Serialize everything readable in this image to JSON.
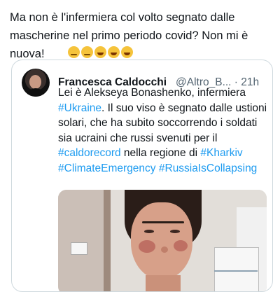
{
  "outer_tweet": {
    "text": "Ma non è l'infermiera col volto segnato dalle mascherine nel primo periodo covid? Non mi è nuova!",
    "emojis": [
      "thinking-face-icon",
      "eye-roll-icon",
      "rolling-laugh-icon",
      "rolling-laugh-icon",
      "rolling-laugh-icon"
    ]
  },
  "quoted_tweet": {
    "author_name": "Francesca Caldocchi",
    "handle": "@Altro_B...",
    "timestamp": "· 21h",
    "more_label": "⋮",
    "text_segments": [
      {
        "text": "Lei è Alekseya Bonashenko, infermiera ",
        "type": "text"
      },
      {
        "text": "#Ukraine",
        "type": "hashtag"
      },
      {
        "text": ". Il suo viso è segnato dalle ustioni solari, che ha subito soccorrendo i soldati sia ucraini che russi svenuti per il ",
        "type": "text"
      },
      {
        "text": "#caldorecord",
        "type": "hashtag"
      },
      {
        "text": " nella regione di ",
        "type": "text"
      },
      {
        "text": "#Kharkiv",
        "type": "hashtag"
      },
      {
        "text": " ",
        "type": "text"
      },
      {
        "text": "#ClimateEmergency",
        "type": "hashtag"
      },
      {
        "text": " ",
        "type": "text"
      },
      {
        "text": "#RussiaIsCollapsing",
        "type": "hashtag"
      }
    ],
    "hashtag_color": "#1d9bf0"
  }
}
